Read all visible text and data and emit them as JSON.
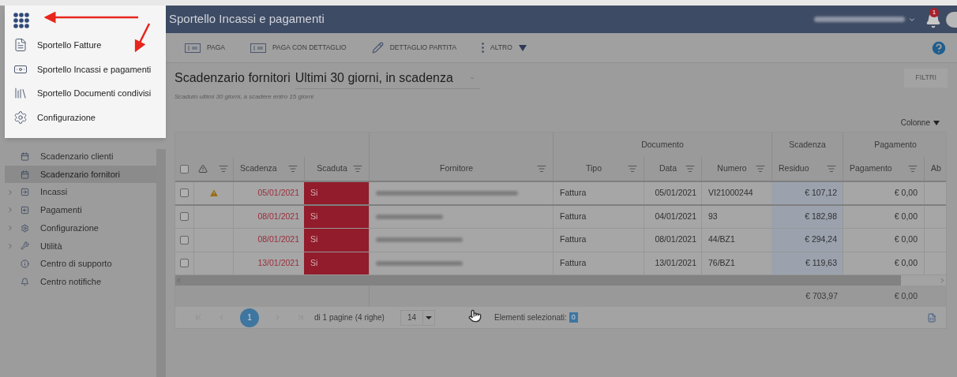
{
  "app_menu": {
    "items": [
      {
        "label": "Sportello Fatture",
        "selected": false
      },
      {
        "label": "Sportello Incassi e pagamenti",
        "selected": false
      },
      {
        "label": "Sportello Documenti condivisi",
        "selected": false
      },
      {
        "label": "Configurazione",
        "selected": false
      }
    ]
  },
  "header": {
    "title": "Sportello Incassi e pagamenti",
    "notifications": "1"
  },
  "toolbar": {
    "buttons": [
      {
        "label": "PAGA",
        "dropdown": false
      },
      {
        "label": "PAGA CON DETTAGLIO",
        "dropdown": false
      },
      {
        "label": "DETTAGLIO PARTITA",
        "dropdown": false
      },
      {
        "label": "ALTRO",
        "dropdown": true
      }
    ]
  },
  "sidebar": {
    "items": [
      {
        "label": "Scadenzario clienti",
        "expandable": false,
        "selected": false
      },
      {
        "label": "Scadenzario fornitori",
        "expandable": false,
        "selected": true
      },
      {
        "label": "Incassi",
        "expandable": true,
        "selected": false
      },
      {
        "label": "Pagamenti",
        "expandable": true,
        "selected": false
      },
      {
        "label": "Configurazione",
        "expandable": true,
        "selected": false
      },
      {
        "label": "Utilità",
        "expandable": true,
        "selected": false
      },
      {
        "label": "Centro di supporto",
        "expandable": false,
        "selected": false
      },
      {
        "label": "Centro notifiche",
        "expandable": false,
        "selected": false
      }
    ]
  },
  "page": {
    "title": "Scadenzario fornitori",
    "view": "Ultimi 30 giorni, in scadenza",
    "subtitle": "Scaduto ultimi 30 giorni, a scadere entro 15 giorni",
    "filter_button": "FILTRI",
    "columns_button": "Colonne"
  },
  "table": {
    "all_checked": false,
    "groups": [
      "Documento",
      "Scadenza",
      "Pagamento"
    ],
    "columns": [
      "Scadenza",
      "Scaduta",
      "Fornitore",
      "Tipo",
      "Data",
      "Numero",
      "Residuo",
      "Pagamento",
      "Ab"
    ],
    "rows": [
      {
        "checked": false,
        "warning": true,
        "scadenza": "05/01/2021",
        "scaduta": "Si",
        "tipo": "Fattura",
        "data": "05/01/2021",
        "numero": "VI21000244",
        "residuo": "€ 107,12",
        "pagamento": "€ 0,00"
      },
      {
        "checked": false,
        "warning": false,
        "scadenza": "08/01/2021",
        "scaduta": "Si",
        "tipo": "Fattura",
        "data": "04/01/2021",
        "numero": "93",
        "residuo": "€ 182,98",
        "pagamento": "€ 0,00"
      },
      {
        "checked": false,
        "warning": false,
        "scadenza": "08/01/2021",
        "scaduta": "Si",
        "tipo": "Fattura",
        "data": "08/01/2021",
        "numero": "44/BZ1",
        "residuo": "€ 294,24",
        "pagamento": "€ 0,00"
      },
      {
        "checked": false,
        "warning": false,
        "scadenza": "13/01/2021",
        "scaduta": "Si",
        "tipo": "Fattura",
        "data": "13/01/2021",
        "numero": "76/BZ1",
        "residuo": "€ 119,63",
        "pagamento": "€ 0,00"
      }
    ],
    "totals": {
      "residuo": "€ 703,97",
      "pagamento": "€ 0,00"
    }
  },
  "pager": {
    "page": "1",
    "info": "di 1 pagine (4 righe)",
    "page_size": "14",
    "selected_label": "Elementi selezionati:",
    "selected_count": "0"
  }
}
